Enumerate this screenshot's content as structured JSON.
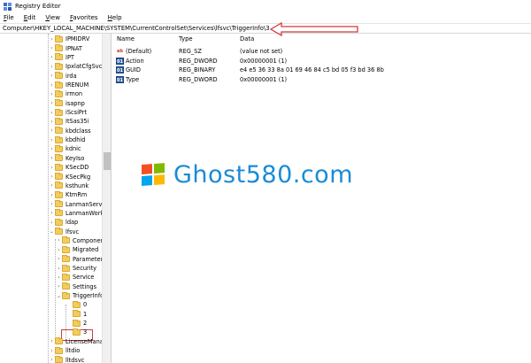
{
  "window": {
    "title": "Registry Editor"
  },
  "menu": {
    "items": [
      "File",
      "Edit",
      "View",
      "Favorites",
      "Help"
    ]
  },
  "address": {
    "path": "Computer\\HKEY_LOCAL_MACHINE\\SYSTEM\\CurrentControlSet\\Services\\lfsvc\\TriggerInfo\\3"
  },
  "tree": {
    "items": [
      {
        "label": "IPMIDRV",
        "depth": 0
      },
      {
        "label": "IPNAT",
        "depth": 0
      },
      {
        "label": "IPT",
        "depth": 0
      },
      {
        "label": "IpxlatCfgSvc",
        "depth": 0
      },
      {
        "label": "irda",
        "depth": 0
      },
      {
        "label": "IRENUM",
        "depth": 0
      },
      {
        "label": "irmon",
        "depth": 0
      },
      {
        "label": "isapnp",
        "depth": 0
      },
      {
        "label": "iScsiPrt",
        "depth": 0
      },
      {
        "label": "ItSas35i",
        "depth": 0
      },
      {
        "label": "kbdclass",
        "depth": 0
      },
      {
        "label": "kbdhid",
        "depth": 0
      },
      {
        "label": "kdnic",
        "depth": 0
      },
      {
        "label": "KeyIso",
        "depth": 0
      },
      {
        "label": "KSecDD",
        "depth": 0
      },
      {
        "label": "KSecPkg",
        "depth": 0
      },
      {
        "label": "ksthunk",
        "depth": 0
      },
      {
        "label": "KtmRm",
        "depth": 0
      },
      {
        "label": "LanmanServer",
        "depth": 0
      },
      {
        "label": "LanmanWorks",
        "depth": 0
      },
      {
        "label": "ldap",
        "depth": 0
      },
      {
        "label": "lfsvc",
        "depth": 0
      },
      {
        "label": "Componen",
        "depth": 1
      },
      {
        "label": "Migrated",
        "depth": 1
      },
      {
        "label": "Parameters",
        "depth": 1
      },
      {
        "label": "Security",
        "depth": 1
      },
      {
        "label": "Service",
        "depth": 1
      },
      {
        "label": "Settings",
        "depth": 1
      },
      {
        "label": "TriggerInfo",
        "depth": 1
      },
      {
        "label": "0",
        "depth": 2
      },
      {
        "label": "1",
        "depth": 2
      },
      {
        "label": "2",
        "depth": 2
      },
      {
        "label": "3",
        "depth": 2
      },
      {
        "label": "LicenseManag",
        "depth": 0
      },
      {
        "label": "lltdio",
        "depth": 0
      },
      {
        "label": "lltdsvc",
        "depth": 0
      }
    ]
  },
  "values": {
    "columns": [
      "Name",
      "Type",
      "Data"
    ],
    "rows": [
      {
        "icon": "string-value-icon",
        "name": "(Default)",
        "type": "REG_SZ",
        "data": "(value not set)"
      },
      {
        "icon": "binary-value-icon",
        "name": "Action",
        "type": "REG_DWORD",
        "data": "0x00000001 (1)"
      },
      {
        "icon": "binary-value-icon",
        "name": "GUID",
        "type": "REG_BINARY",
        "data": "e4 e5 36 33 8a 01 69 46 84 c5 bd 05 f3 bd 36 8b"
      },
      {
        "icon": "binary-value-icon",
        "name": "Type",
        "type": "REG_DWORD",
        "data": "0x00000001 (1)"
      }
    ]
  },
  "watermark": {
    "text": "Ghost580.com"
  },
  "colors": {
    "annotation": "#d23a3a",
    "watermark": "#1a8bd6",
    "folder": "#f3cd5b"
  }
}
